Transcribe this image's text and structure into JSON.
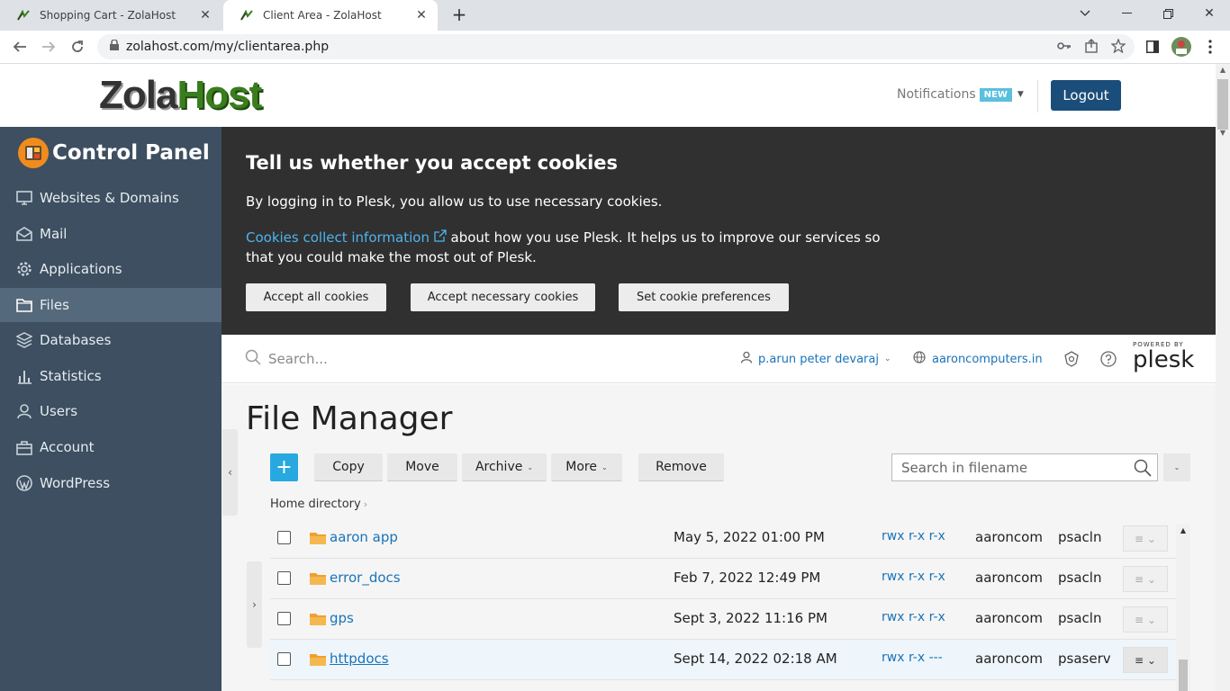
{
  "browser": {
    "tabs": [
      {
        "title": "Shopping Cart - ZolaHost"
      },
      {
        "title": "Client Area - ZolaHost"
      }
    ],
    "url": "zolahost.com/my/clientarea.php"
  },
  "site": {
    "logo_part1": "Zola",
    "logo_part2": "Host",
    "notifications_label": "Notifications",
    "notifications_badge": "NEW",
    "logout_label": "Logout"
  },
  "sidebar": {
    "title": "Control Panel",
    "items": [
      {
        "label": "Websites & Domains",
        "icon": "monitor-icon"
      },
      {
        "label": "Mail",
        "icon": "mail-icon"
      },
      {
        "label": "Applications",
        "icon": "gear-icon"
      },
      {
        "label": "Files",
        "icon": "folder-icon"
      },
      {
        "label": "Databases",
        "icon": "database-icon"
      },
      {
        "label": "Statistics",
        "icon": "bar-chart-icon"
      },
      {
        "label": "Users",
        "icon": "user-icon"
      },
      {
        "label": "Account",
        "icon": "briefcase-icon"
      },
      {
        "label": "WordPress",
        "icon": "wordpress-icon"
      }
    ],
    "active_index": 3
  },
  "cookie": {
    "title": "Tell us whether you accept cookies",
    "text1": "By logging in to Plesk, you allow us to use necessary cookies.",
    "link": "Cookies collect information",
    "text2": " about how you use Plesk. It helps us to improve our services so that you could make the most out of Plesk.",
    "btn_accept_all": "Accept all cookies",
    "btn_accept_necessary": "Accept necessary cookies",
    "btn_preferences": "Set cookie preferences"
  },
  "plesk_header": {
    "search_placeholder": "Search...",
    "user": "p.arun peter devaraj",
    "domain": "aaroncomputers.in",
    "powered_by": "POWERED BY",
    "brand": "plesk"
  },
  "file_manager": {
    "title": "File Manager",
    "toolbar": {
      "add": "+",
      "copy": "Copy",
      "move": "Move",
      "archive": "Archive",
      "more": "More",
      "remove": "Remove",
      "search_placeholder": "Search in filename"
    },
    "breadcrumb": "Home directory",
    "rows": [
      {
        "name": "aaron app",
        "date": "May 5, 2022 01:00 PM",
        "perm": "rwx r-x r-x",
        "owner": "aaroncom",
        "group": "psacln"
      },
      {
        "name": "error_docs",
        "date": "Feb 7, 2022 12:49 PM",
        "perm": "rwx r-x r-x",
        "owner": "aaroncom",
        "group": "psacln"
      },
      {
        "name": "gps",
        "date": "Sept 3, 2022 11:16 PM",
        "perm": "rwx r-x r-x",
        "owner": "aaroncom",
        "group": "psacln"
      },
      {
        "name": "httpdocs",
        "date": "Sept 14, 2022 02:18 AM",
        "perm": "rwx r-x ---",
        "owner": "aaroncom",
        "group": "psaserv"
      }
    ]
  },
  "colors": {
    "sidebar_bg": "#3d4f60",
    "sidebar_active": "#55697c",
    "logout_bg": "#1b4d7a",
    "cookie_bg": "#303030",
    "link": "#1a73b8",
    "add_button": "#28a8e0",
    "folder": "#f0a030"
  }
}
